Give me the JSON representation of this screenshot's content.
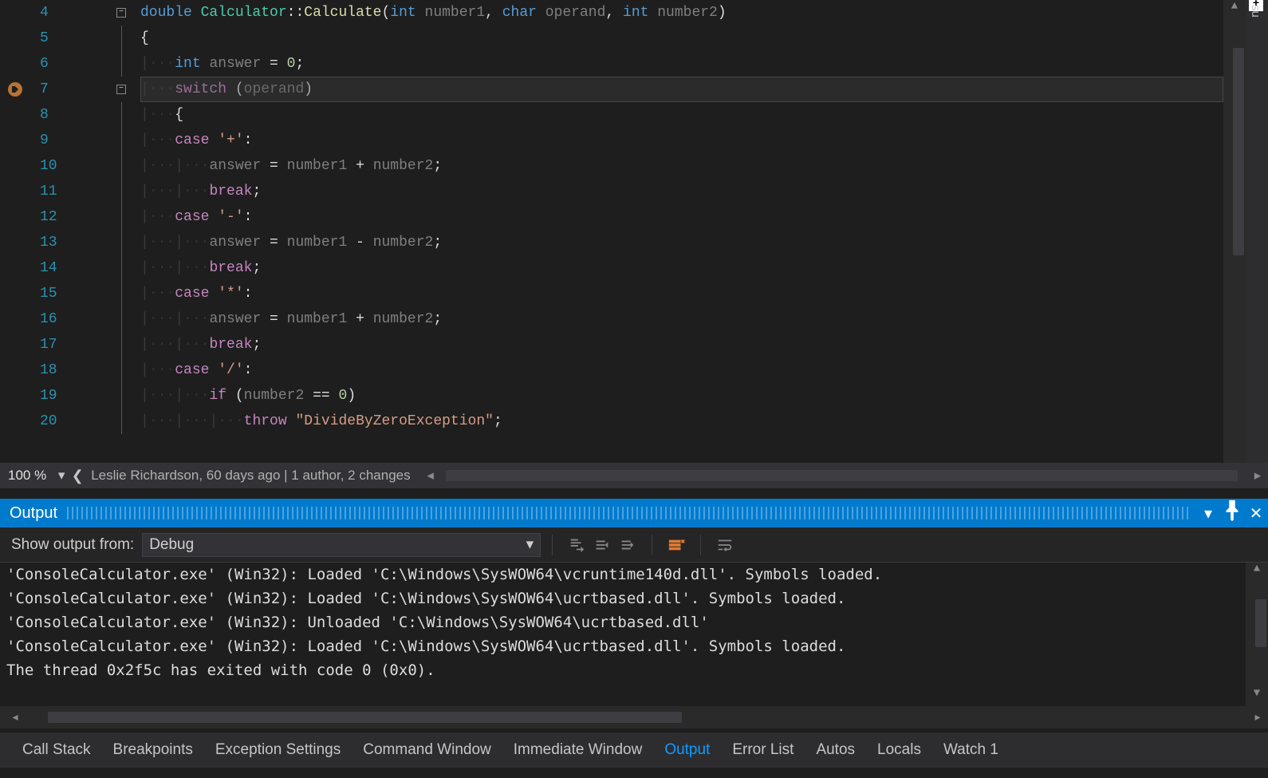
{
  "editor": {
    "breakpoint_line": 7,
    "current_line": 7,
    "lines": [
      {
        "n": 4,
        "fold": "minus",
        "tokens": [
          [
            "kw",
            "double"
          ],
          [
            "txt",
            " "
          ],
          [
            "type",
            "Calculator"
          ],
          [
            "txt",
            "::"
          ],
          [
            "func",
            "Calculate"
          ],
          [
            "txt",
            "("
          ],
          [
            "kw",
            "int"
          ],
          [
            "txt",
            " "
          ],
          [
            "id",
            "number1"
          ],
          [
            "txt",
            ", "
          ],
          [
            "kw",
            "char"
          ],
          [
            "txt",
            " "
          ],
          [
            "id",
            "operand"
          ],
          [
            "txt",
            ", "
          ],
          [
            "kw",
            "int"
          ],
          [
            "txt",
            " "
          ],
          [
            "id",
            "number2"
          ],
          [
            "txt",
            ")"
          ]
        ]
      },
      {
        "n": 5,
        "fold": "line",
        "indent": 0,
        "tokens": [
          [
            "txt",
            "{"
          ]
        ]
      },
      {
        "n": 6,
        "fold": "line",
        "indent": 1,
        "tokens": [
          [
            "kw",
            "int"
          ],
          [
            "txt",
            " "
          ],
          [
            "id",
            "answer"
          ],
          [
            "txt",
            " = "
          ],
          [
            "num",
            "0"
          ],
          [
            "txt",
            ";"
          ]
        ]
      },
      {
        "n": 7,
        "fold": "minus",
        "indent": 1,
        "tokens": [
          [
            "cflow",
            "switch"
          ],
          [
            "txt",
            " ("
          ],
          [
            "id",
            "operand"
          ],
          [
            "txt",
            ")"
          ]
        ]
      },
      {
        "n": 8,
        "fold": "line",
        "indent": 1,
        "tokens": [
          [
            "txt",
            "{"
          ]
        ]
      },
      {
        "n": 9,
        "fold": "line",
        "indent": 1,
        "tokens": [
          [
            "cflow",
            "case"
          ],
          [
            "txt",
            " "
          ],
          [
            "str",
            "'+'"
          ],
          [
            "txt",
            ":"
          ]
        ]
      },
      {
        "n": 10,
        "fold": "line",
        "indent": 2,
        "tokens": [
          [
            "id",
            "answer"
          ],
          [
            "txt",
            " = "
          ],
          [
            "id",
            "number1"
          ],
          [
            "txt",
            " + "
          ],
          [
            "id",
            "number2"
          ],
          [
            "txt",
            ";"
          ]
        ]
      },
      {
        "n": 11,
        "fold": "line",
        "indent": 2,
        "tokens": [
          [
            "cflow",
            "break"
          ],
          [
            "txt",
            ";"
          ]
        ]
      },
      {
        "n": 12,
        "fold": "line",
        "indent": 1,
        "tokens": [
          [
            "cflow",
            "case"
          ],
          [
            "txt",
            " "
          ],
          [
            "str",
            "'-'"
          ],
          [
            "txt",
            ":"
          ]
        ]
      },
      {
        "n": 13,
        "fold": "line",
        "indent": 2,
        "tokens": [
          [
            "id",
            "answer"
          ],
          [
            "txt",
            " = "
          ],
          [
            "id",
            "number1"
          ],
          [
            "txt",
            " - "
          ],
          [
            "id",
            "number2"
          ],
          [
            "txt",
            ";"
          ]
        ]
      },
      {
        "n": 14,
        "fold": "line",
        "indent": 2,
        "tokens": [
          [
            "cflow",
            "break"
          ],
          [
            "txt",
            ";"
          ]
        ]
      },
      {
        "n": 15,
        "fold": "line",
        "indent": 1,
        "tokens": [
          [
            "cflow",
            "case"
          ],
          [
            "txt",
            " "
          ],
          [
            "str",
            "'*'"
          ],
          [
            "txt",
            ":"
          ]
        ]
      },
      {
        "n": 16,
        "fold": "line",
        "indent": 2,
        "tokens": [
          [
            "id",
            "answer"
          ],
          [
            "txt",
            " = "
          ],
          [
            "id",
            "number1"
          ],
          [
            "txt",
            " + "
          ],
          [
            "id",
            "number2"
          ],
          [
            "txt",
            ";"
          ]
        ]
      },
      {
        "n": 17,
        "fold": "line",
        "indent": 2,
        "tokens": [
          [
            "cflow",
            "break"
          ],
          [
            "txt",
            ";"
          ]
        ]
      },
      {
        "n": 18,
        "fold": "line",
        "indent": 1,
        "tokens": [
          [
            "cflow",
            "case"
          ],
          [
            "txt",
            " "
          ],
          [
            "str",
            "'/'"
          ],
          [
            "txt",
            ":"
          ]
        ]
      },
      {
        "n": 19,
        "fold": "line",
        "indent": 2,
        "tokens": [
          [
            "cflow",
            "if"
          ],
          [
            "txt",
            " ("
          ],
          [
            "id",
            "number2"
          ],
          [
            "txt",
            " == "
          ],
          [
            "num",
            "0"
          ],
          [
            "txt",
            ")"
          ]
        ]
      },
      {
        "n": 20,
        "fold": "line",
        "indent": 3,
        "tokens": [
          [
            "cflow",
            "throw"
          ],
          [
            "txt",
            " "
          ],
          [
            "str",
            "\"DivideByZeroException\""
          ],
          [
            "txt",
            ";"
          ]
        ]
      }
    ]
  },
  "code_status": {
    "zoom": "100 %",
    "blame": "Leslie Richardson, 60 days ago | 1 author, 2 changes"
  },
  "side_tab_1": "su",
  "output_panel": {
    "title": "Output",
    "show_from_label": "Show output from:",
    "source_selected": "Debug",
    "lines": [
      "'ConsoleCalculator.exe' (Win32): Loaded 'C:\\Windows\\SysWOW64\\vcruntime140d.dll'. Symbols loaded.",
      "'ConsoleCalculator.exe' (Win32): Loaded 'C:\\Windows\\SysWOW64\\ucrtbased.dll'. Symbols loaded.",
      "'ConsoleCalculator.exe' (Win32): Unloaded 'C:\\Windows\\SysWOW64\\ucrtbased.dll'",
      "'ConsoleCalculator.exe' (Win32): Loaded 'C:\\Windows\\SysWOW64\\ucrtbased.dll'. Symbols loaded.",
      "The thread 0x2f5c has exited with code 0 (0x0)."
    ]
  },
  "bottom_tabs": {
    "items": [
      "Call Stack",
      "Breakpoints",
      "Exception Settings",
      "Command Window",
      "Immediate Window",
      "Output",
      "Error List",
      "Autos",
      "Locals",
      "Watch 1"
    ],
    "active": "Output"
  }
}
